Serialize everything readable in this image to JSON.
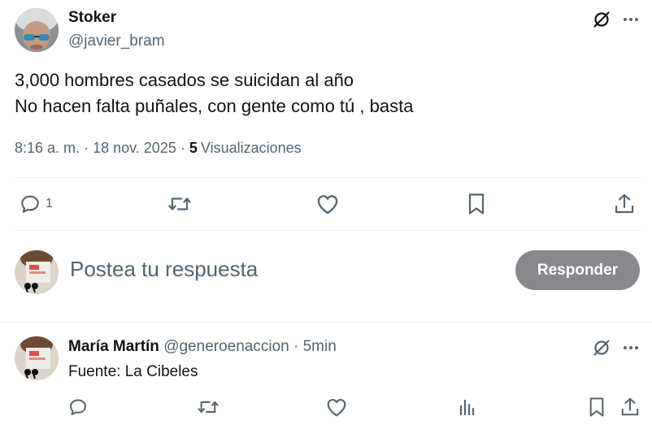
{
  "main_tweet": {
    "display_name": "Stoker",
    "handle": "@javier_bram",
    "text_line1": "3,000 hombres casados se suicidan al año",
    "text_line2": "No hacen falta puñales, con gente como tú , basta",
    "time": "8:16 a. m.",
    "sep1": "·",
    "date": "18 nov. 2025",
    "sep2": "·",
    "views_count": "5",
    "views_label": "Visualizaciones",
    "reply_count": "1",
    "icons": [
      "reply-icon",
      "retweet-icon",
      "like-icon",
      "bookmark-icon",
      "share-icon",
      "grok-icon",
      "more-icon"
    ]
  },
  "composer": {
    "placeholder": "Postea tu respuesta",
    "button_label": "Responder"
  },
  "reply": {
    "display_name": "María Martín",
    "handle": "@generoenaccion",
    "sep": "·",
    "time": "5min",
    "text": "Fuente: La Cibeles",
    "icons": [
      "reply-icon",
      "retweet-icon",
      "like-icon",
      "views-icon",
      "bookmark-icon",
      "share-icon",
      "grok-icon",
      "more-icon"
    ]
  },
  "colors": {
    "text": "#0f1419",
    "muted": "#536471",
    "button_bg": "#87898c",
    "divider": "#eff3f4"
  }
}
